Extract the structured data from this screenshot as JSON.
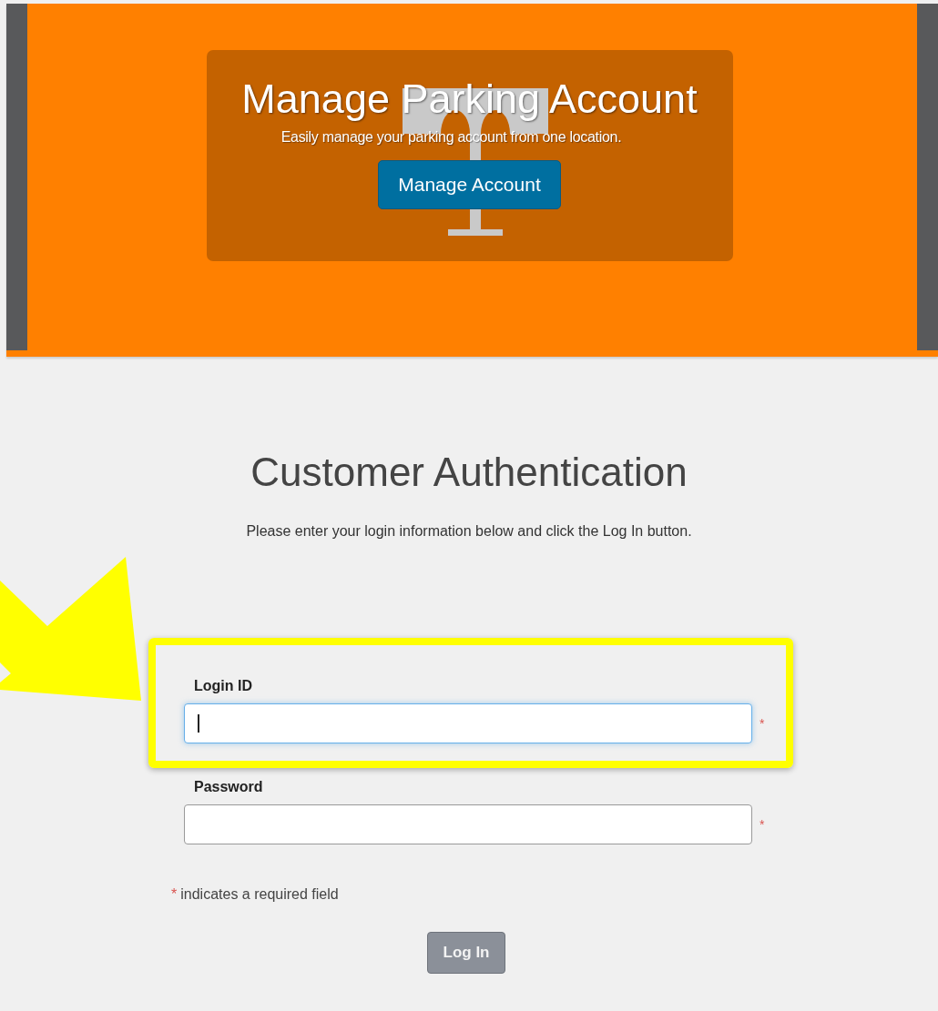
{
  "banner": {
    "title": "Manage Parking Account",
    "subtitle": "Easily manage your parking account from one location.",
    "button": "Manage Account"
  },
  "auth": {
    "title": "Customer Authentication",
    "instruction": "Please enter your login information below and click the Log In button.",
    "fields": [
      {
        "label": "Login ID",
        "focused": true,
        "highlighted": true,
        "required_mark": "*"
      },
      {
        "label": "Password",
        "focused": false,
        "highlighted": false,
        "required_mark": "*"
      }
    ],
    "note": {
      "mark": "*",
      "text": "indicates a required field"
    },
    "login_button": {
      "label": "Log In",
      "disabled": true
    }
  },
  "annotations": [
    {
      "kind": "arrow"
    }
  ]
}
